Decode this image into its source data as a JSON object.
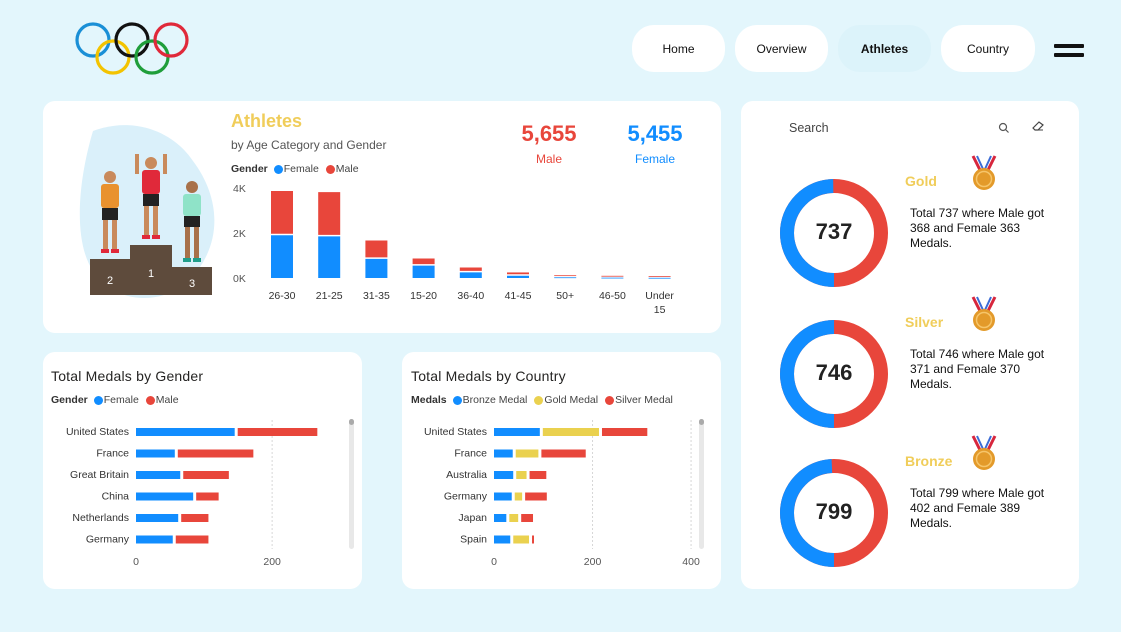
{
  "nav": {
    "home": "Home",
    "overview": "Overview",
    "athletes": "Athletes",
    "country": "Country",
    "active": "Athletes"
  },
  "colors": {
    "female": "#118dff",
    "male": "#e8463b",
    "gold": "#ead14f",
    "title_gold": "#f0cd5a",
    "background": "#e3f6fc"
  },
  "athletes_card": {
    "title": "Athletes",
    "subtitle": "by Age Category and Gender",
    "male_count": "5,655",
    "male_label": "Male",
    "female_count": "5,455",
    "female_label": "Female",
    "podium_numbers": [
      "2",
      "1",
      "3"
    ],
    "legend": {
      "title": "Gender",
      "female": "Female",
      "male": "Male"
    }
  },
  "search": {
    "placeholder": "Search"
  },
  "medals": [
    {
      "name": "Gold",
      "total": "737",
      "description": "Total 737 where Male got 368 and Female 363 Medals.",
      "male": 368,
      "female": 363,
      "medal_color": "#e39a2a",
      "icon": "gold-medal-icon"
    },
    {
      "name": "Silver",
      "total": "746",
      "description": "Total 746 where Male got 371 and Female 370 Medals.",
      "male": 371,
      "female": 370,
      "medal_color": "#e39a2a",
      "icon": "silver-medal-icon"
    },
    {
      "name": "Bronze",
      "total": "799",
      "description": "Total 799 where Male got 402 and Female 389 Medals.",
      "male": 402,
      "female": 389,
      "medal_color": "#e39a2a",
      "icon": "bronze-medal-icon"
    }
  ],
  "gender_card": {
    "title": "Total Medals by Gender",
    "legend": {
      "title": "Gender",
      "female": "Female",
      "male": "Male"
    }
  },
  "country_card": {
    "title": "Total Medals by Country",
    "legend": {
      "title": "Medals",
      "bronze": "Bronze Medal",
      "gold": "Gold Medal",
      "silver": "Silver Medal"
    }
  },
  "chart_data": [
    {
      "type": "bar",
      "stacked": true,
      "orientation": "vertical",
      "title": "Athletes",
      "subtitle": "by Age Category and Gender",
      "categories": [
        "26-30",
        "21-25",
        "31-35",
        "15-20",
        "36-40",
        "41-45",
        "50+",
        "46-50",
        "Under 15"
      ],
      "series": [
        {
          "name": "Female",
          "color": "#118dff",
          "values": [
            1900,
            1850,
            850,
            550,
            250,
            100,
            30,
            15,
            8
          ]
        },
        {
          "name": "Male",
          "color": "#e8463b",
          "values": [
            1900,
            1900,
            750,
            250,
            150,
            80,
            25,
            15,
            5
          ]
        }
      ],
      "yticks": [
        "0K",
        "2K",
        "4K"
      ],
      "ylim": [
        0,
        4000
      ],
      "grid": false,
      "legend": "top-left"
    },
    {
      "type": "bar",
      "stacked": true,
      "orientation": "horizontal",
      "title": "Total Medals by Gender",
      "categories": [
        "United States",
        "France",
        "Great Britain",
        "China",
        "Netherlands",
        "Germany"
      ],
      "series": [
        {
          "name": "Female",
          "color": "#118dff",
          "values": [
            145,
            57,
            65,
            84,
            62,
            54
          ]
        },
        {
          "name": "Male",
          "color": "#e8463b",
          "values": [
            117,
            111,
            67,
            33,
            40,
            48
          ]
        }
      ],
      "xticks": [
        "0",
        "200"
      ],
      "xlim": [
        0,
        310
      ],
      "legend": "top-left"
    },
    {
      "type": "bar",
      "stacked": true,
      "orientation": "horizontal",
      "title": "Total Medals by Country",
      "categories": [
        "United States",
        "France",
        "Australia",
        "Germany",
        "Japan",
        "Spain"
      ],
      "series": [
        {
          "name": "Bronze Medal",
          "color": "#118dff",
          "values": [
            93,
            38,
            39,
            36,
            25,
            33
          ]
        },
        {
          "name": "Gold Medal",
          "color": "#ead14f",
          "values": [
            114,
            46,
            21,
            15,
            18,
            32
          ]
        },
        {
          "name": "Silver Medal",
          "color": "#e8463b",
          "values": [
            92,
            90,
            34,
            44,
            24,
            4
          ]
        }
      ],
      "xticks": [
        "0",
        "200",
        "400"
      ],
      "xlim": [
        0,
        410
      ],
      "legend": "top-left"
    }
  ]
}
